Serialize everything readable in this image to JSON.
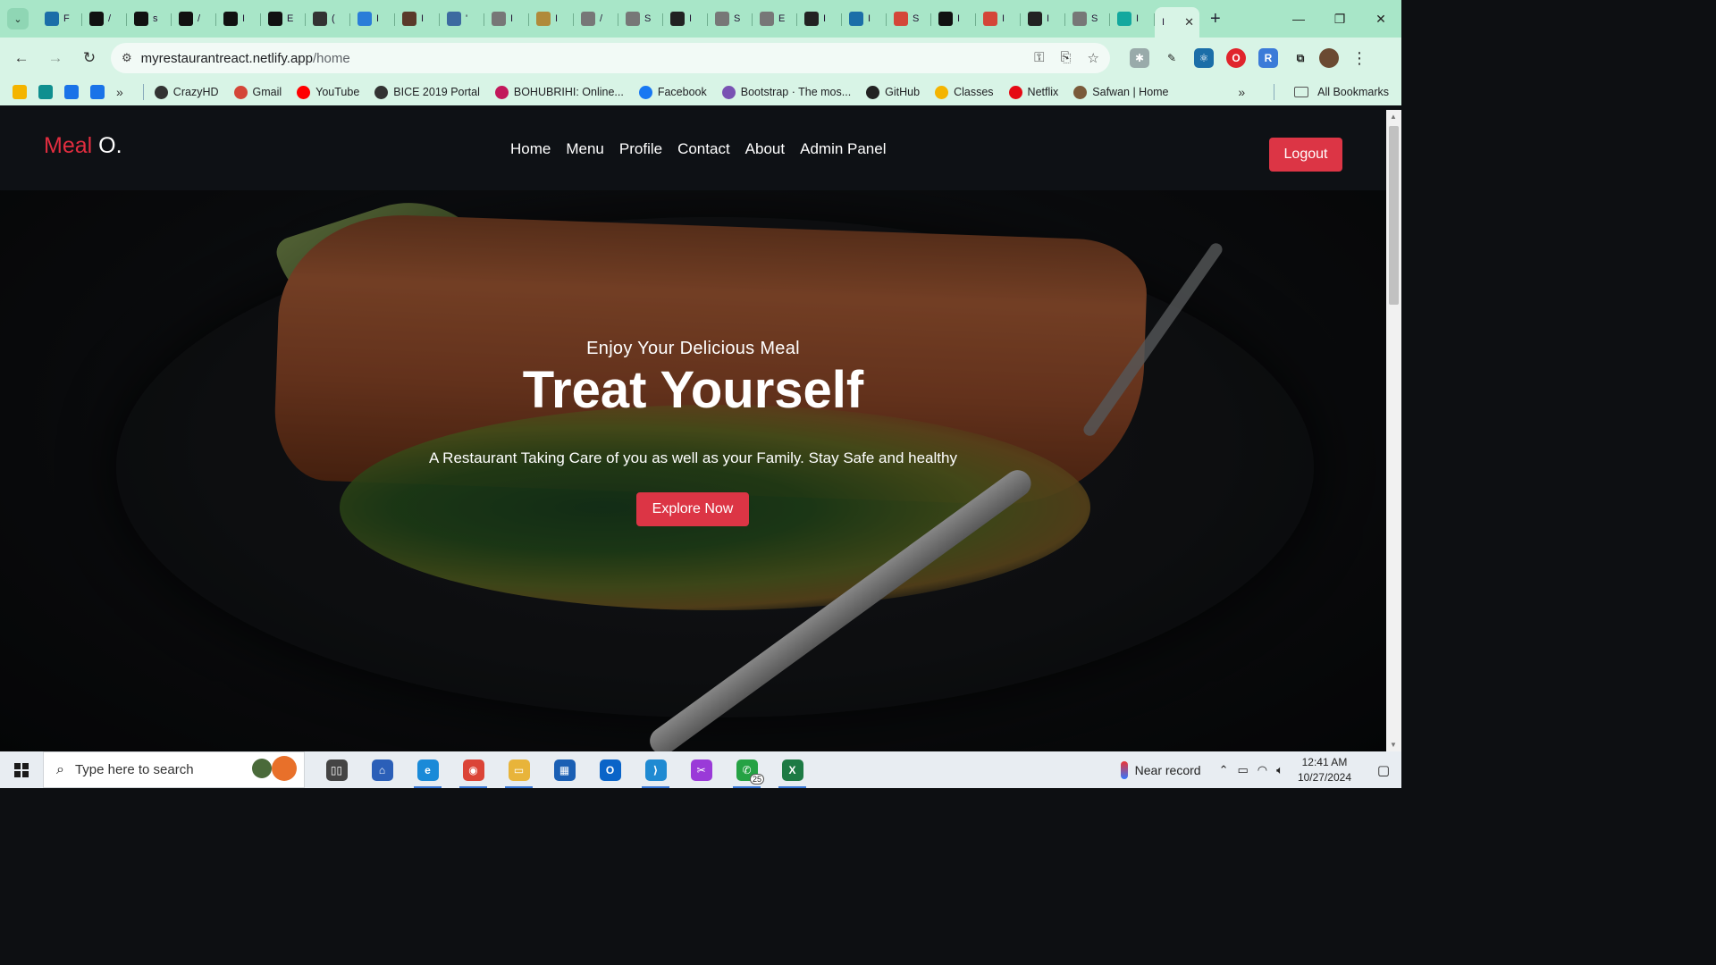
{
  "browser": {
    "tabs": [
      {
        "icon": "react-icon",
        "title": "F",
        "color": "#1b6ea8"
      },
      {
        "icon": "framer-icon",
        "title": "/",
        "color": "#111111"
      },
      {
        "icon": "square-icon",
        "title": "s",
        "color": "#111111"
      },
      {
        "icon": "square-icon",
        "title": "/",
        "color": "#111111"
      },
      {
        "icon": "square-icon",
        "title": "I",
        "color": "#111111"
      },
      {
        "icon": "square-icon",
        "title": "E",
        "color": "#111111"
      },
      {
        "icon": "openai-icon",
        "title": "(",
        "color": "#333333"
      },
      {
        "icon": "bird-icon",
        "title": "I",
        "color": "#2a7dd8"
      },
      {
        "icon": "avatar-icon",
        "title": "I",
        "color": "#5a3a2a"
      },
      {
        "icon": "person-icon",
        "title": "'",
        "color": "#3d6aa0"
      },
      {
        "icon": "globe-icon",
        "title": "I",
        "color": "#777777"
      },
      {
        "icon": "leaf-icon",
        "title": "I",
        "color": "#b08a3a"
      },
      {
        "icon": "globe-icon",
        "title": "/",
        "color": "#777777"
      },
      {
        "icon": "globe-icon",
        "title": "S",
        "color": "#777777"
      },
      {
        "icon": "tiktok-icon",
        "title": "I",
        "color": "#222222"
      },
      {
        "icon": "globe-icon",
        "title": "S",
        "color": "#777777"
      },
      {
        "icon": "globe-icon",
        "title": "E",
        "color": "#777777"
      },
      {
        "icon": "tiktok-icon",
        "title": "I",
        "color": "#222222"
      },
      {
        "icon": "react-icon",
        "title": "I",
        "color": "#1b6ea8"
      },
      {
        "icon": "gmail-icon",
        "title": "S",
        "color": "#d44638"
      },
      {
        "icon": "square-icon",
        "title": "I",
        "color": "#111111"
      },
      {
        "icon": "gmail-icon",
        "title": "I",
        "color": "#d44638"
      },
      {
        "icon": "github-icon",
        "title": "I",
        "color": "#222222"
      },
      {
        "icon": "globe-icon",
        "title": "S",
        "color": "#777777"
      },
      {
        "icon": "diamond-icon",
        "title": "I",
        "color": "#13a89e"
      }
    ],
    "active_tab": {
      "title": "I",
      "close": "✕"
    },
    "new_tab": "+",
    "window_controls": {
      "minimize": "—",
      "maximize": "❐",
      "close": "✕"
    },
    "url": {
      "host": "myrestaurantreact.netlify.app",
      "path": "/home"
    },
    "bookmarks": [
      {
        "label": "CrazyHD",
        "icon": "globe-dark-icon",
        "color": "#333333"
      },
      {
        "label": "Gmail",
        "icon": "gmail-icon",
        "color": "#d44638"
      },
      {
        "label": "YouTube",
        "icon": "youtube-icon",
        "color": "#ff0000"
      },
      {
        "label": "BICE 2019 Portal",
        "icon": "globe-dark-icon",
        "color": "#333333"
      },
      {
        "label": "BOHUBRIHI: Online...",
        "icon": "bohubrihi-icon",
        "color": "#c2185b"
      },
      {
        "label": "Facebook",
        "icon": "facebook-icon",
        "color": "#1877f2"
      },
      {
        "label": "Bootstrap · The mos...",
        "icon": "bootstrap-icon",
        "color": "#7952b3"
      },
      {
        "label": "GitHub",
        "icon": "github-icon",
        "color": "#222222"
      },
      {
        "label": "Classes",
        "icon": "classroom-icon",
        "color": "#f4b400"
      },
      {
        "label": "Netflix",
        "icon": "netflix-icon",
        "color": "#e50914"
      },
      {
        "label": "Safwan | Home",
        "icon": "avatar-icon",
        "color": "#7a5a3a"
      }
    ],
    "bookmark_squares": [
      "#f4b400",
      "#0f8f8f",
      "#1a73e8",
      "#1a73e8"
    ],
    "all_bookmarks": "All Bookmarks"
  },
  "site": {
    "brand_first": "Meal",
    "brand_second": "O.",
    "nav": [
      "Home",
      "Menu",
      "Profile",
      "Contact",
      "About",
      "Admin Panel"
    ],
    "logout": "Logout",
    "hero": {
      "kicker": "Enjoy Your Delicious Meal",
      "headline": "Treat Yourself",
      "tagline": "A Restaurant Taking Care of you as well as your Family. Stay Safe and healthy",
      "cta": "Explore Now"
    },
    "accent_color": "#dc3545"
  },
  "taskbar": {
    "search_placeholder": "Type here to search",
    "apps": [
      {
        "name": "task-view-icon",
        "color": "#444444",
        "glyph": "▯▯"
      },
      {
        "name": "network-app-icon",
        "color": "#2b5fb8",
        "glyph": "⌂"
      },
      {
        "name": "edge-icon",
        "color": "#1a8ad8",
        "glyph": "e",
        "open": true
      },
      {
        "name": "chrome-icon",
        "color": "#db4437",
        "glyph": "◉",
        "open": true
      },
      {
        "name": "file-explorer-icon",
        "color": "#e8b43a",
        "glyph": "▭",
        "open": true
      },
      {
        "name": "store-icon",
        "color": "#1a5fb4",
        "glyph": "▦"
      },
      {
        "name": "outlook-icon",
        "color": "#0a64c8",
        "glyph": "O"
      },
      {
        "name": "vscode-icon",
        "color": "#1f8ad2",
        "glyph": "⟩",
        "open": true
      },
      {
        "name": "snip-icon",
        "color": "#9a3ad8",
        "glyph": "✂"
      },
      {
        "name": "whatsapp-icon",
        "color": "#25a244",
        "glyph": "✆",
        "open": true
      },
      {
        "name": "excel-icon",
        "color": "#1d7a44",
        "glyph": "X",
        "open": true
      }
    ],
    "whatsapp_badge": "25",
    "weather": "Near record",
    "time": "12:41 AM",
    "date": "10/27/2024"
  }
}
